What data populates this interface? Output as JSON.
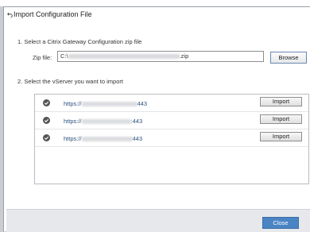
{
  "dialog": {
    "title": "Import Configuration File"
  },
  "step1": {
    "label": "1. Select a Citrix Gateway Configuration zip file",
    "zip_label": "Zip file:",
    "zip_prefix": "C:\\",
    "zip_suffix": ".zip",
    "browse_label": "Browse"
  },
  "step2": {
    "label": "2. Select the vServer you want to import",
    "rows": [
      {
        "url_prefix": "https://",
        "url_suffix": "443",
        "import_label": "Import"
      },
      {
        "url_prefix": "https://",
        "url_suffix": ":443",
        "import_label": "Import"
      },
      {
        "url_prefix": "https://",
        "url_suffix": "443",
        "import_label": "Import"
      }
    ]
  },
  "footer": {
    "close_label": "Close"
  }
}
